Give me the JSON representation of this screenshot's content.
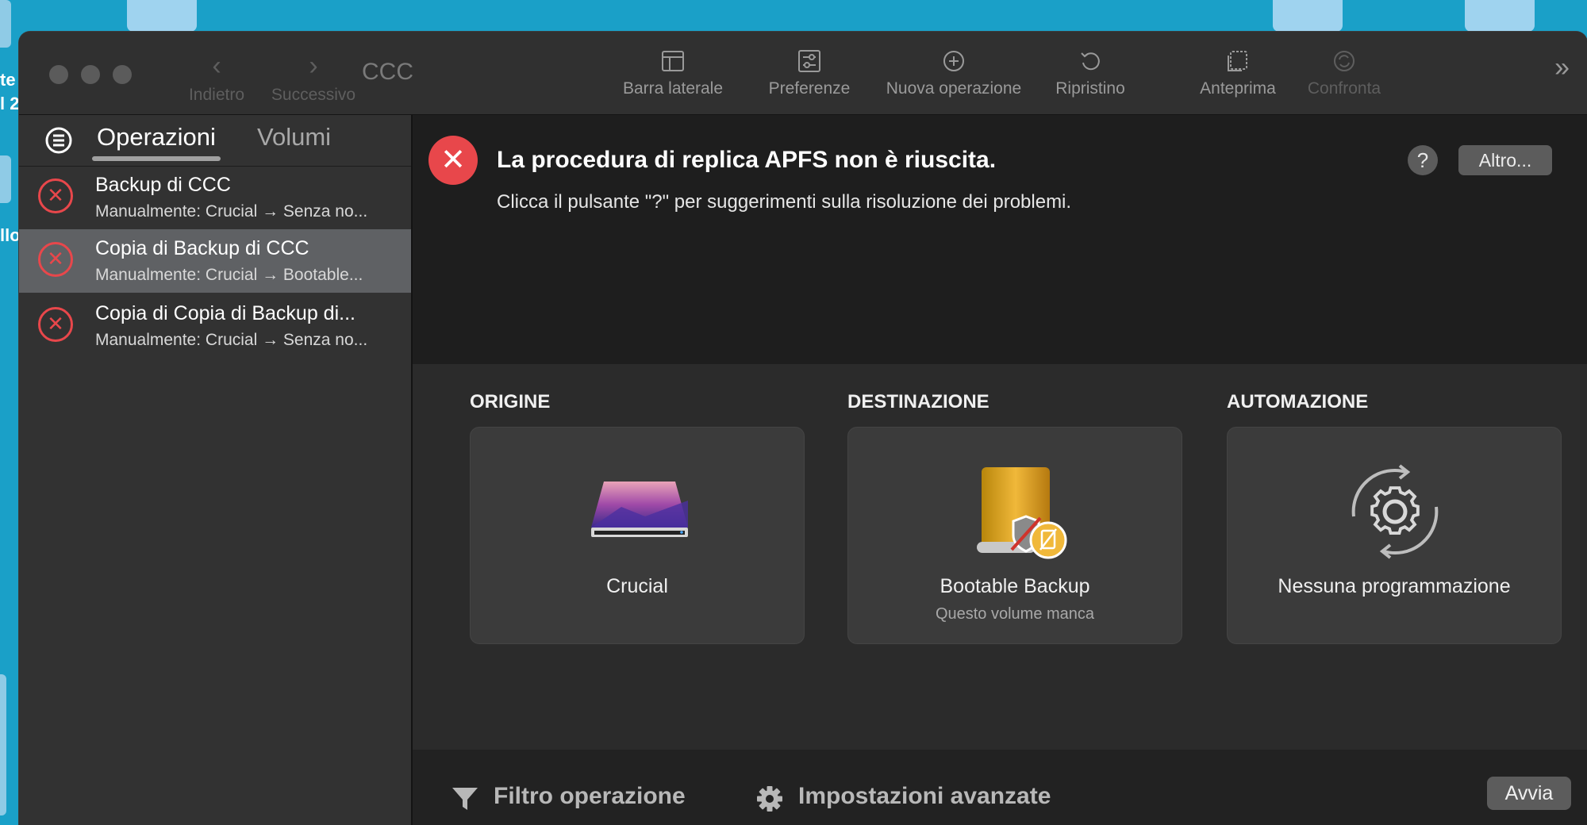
{
  "desktop": {
    "left_text": [
      "te",
      "l 2",
      "llo"
    ]
  },
  "window": {
    "title": "CCC",
    "nav": {
      "back_label": "Indietro",
      "forward_label": "Successivo"
    },
    "toolbar": [
      {
        "label": "Barra laterale",
        "icon": "sidebar-icon",
        "enabled": true
      },
      {
        "label": "Preferenze",
        "icon": "preferences-icon",
        "enabled": true
      },
      {
        "label": "Nuova operazione",
        "icon": "plus-circle-icon",
        "enabled": true
      },
      {
        "label": "Ripristino",
        "icon": "restore-icon",
        "enabled": true
      },
      {
        "label": "Anteprima",
        "icon": "preview-icon",
        "enabled": true
      },
      {
        "label": "Confronta",
        "icon": "compare-icon",
        "enabled": false
      }
    ],
    "overflow_icon": "»"
  },
  "sidebar": {
    "tabs": [
      {
        "label": "Operazioni",
        "active": true
      },
      {
        "label": "Volumi",
        "active": false
      }
    ],
    "tasks": [
      {
        "name": "Backup di CCC",
        "subtitle": "Manualmente: Crucial → Senza no...",
        "status": "error",
        "selected": false
      },
      {
        "name": "Copia di Backup di CCC",
        "subtitle": "Manualmente: Crucial → Bootable...",
        "status": "error",
        "selected": true
      },
      {
        "name": "Copia di Copia di Backup di...",
        "subtitle": "Manualmente: Crucial → Senza no...",
        "status": "error",
        "selected": false
      }
    ]
  },
  "alert": {
    "title": "La procedura di replica APFS non è riuscita.",
    "message": "Clicca il pulsante \"?\" per suggerimenti sulla risoluzione dei problemi.",
    "help_label": "?",
    "more_label": "Altro..."
  },
  "panels": {
    "source": {
      "heading": "ORIGINE",
      "label": "Crucial"
    },
    "destination": {
      "heading": "DESTINAZIONE",
      "label": "Bootable Backup",
      "sublabel": "Questo volume manca"
    },
    "automation": {
      "heading": "AUTOMAZIONE",
      "label": "Nessuna programmazione"
    }
  },
  "bottombar": {
    "filter_label": "Filtro operazione",
    "advanced_label": "Impostazioni avanzate",
    "start_label": "Avvia"
  },
  "colors": {
    "error": "#e8474b",
    "window_bg": "#1e1e1e",
    "desktop": "#1aa0c8"
  }
}
